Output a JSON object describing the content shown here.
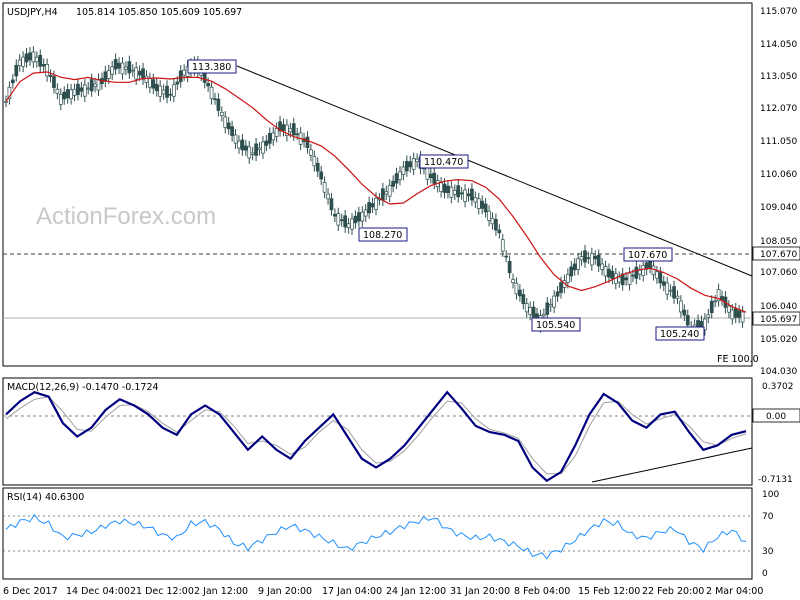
{
  "header": {
    "symbol": "USDJPY,H4",
    "ohlc": "105.814 105.850 105.609 105.697"
  },
  "watermark": "ActionForex.com",
  "colors": {
    "candle": "#2f4f4f",
    "ma": "#cc1111",
    "box_border": "#1a1a80",
    "macd_line": "#000080",
    "macd_signal": "#a0a0a0",
    "rsi": "#1e90ff",
    "grid_dash": "#808080",
    "trend": "#000000"
  },
  "price_panel": {
    "y_ticks": [
      "115.070",
      "114.050",
      "113.050",
      "112.070",
      "111.050",
      "110.060",
      "109.040",
      "108.050",
      "107.060",
      "106.040",
      "105.020",
      "104.030"
    ],
    "current_price": "105.697",
    "dashed_level": "107.670",
    "fe_label": "FE 100.0",
    "annotations": [
      {
        "text": "113.380",
        "value": 113.38
      },
      {
        "text": "110.470",
        "value": 110.47
      },
      {
        "text": "108.270",
        "value": 108.27
      },
      {
        "text": "107.670",
        "value": 107.67
      },
      {
        "text": "105.540",
        "value": 105.54
      },
      {
        "text": "105.240",
        "value": 105.24
      }
    ]
  },
  "macd_panel": {
    "title": "MACD(12,26,9) -0.1470 -0.1724",
    "y_ticks": [
      "0.3702",
      "0.00",
      "-0.7131"
    ],
    "zero_value": "0.00"
  },
  "rsi_panel": {
    "title": "RSI(14) 40.6300",
    "y_ticks": [
      "100",
      "70",
      "30",
      "0"
    ]
  },
  "x_axis": {
    "labels": [
      "6 Dec 2017",
      "14 Dec 04:00",
      "21 Dec 12:00",
      "2 Jan 12:00",
      "9 Jan 20:00",
      "17 Jan 04:00",
      "24 Jan 12:00",
      "31 Jan 20:00",
      "8 Feb 04:00",
      "15 Feb 12:00",
      "22 Feb 20:00",
      "2 Mar 04:00"
    ]
  },
  "chart_data": [
    {
      "type": "line",
      "title": "USDJPY,H4",
      "x_labels": [
        "6 Dec 2017",
        "14 Dec 04:00",
        "21 Dec 12:00",
        "2 Jan 12:00",
        "9 Jan 20:00",
        "17 Jan 04:00",
        "24 Jan 12:00",
        "31 Jan 20:00",
        "8 Feb 04:00",
        "15 Feb 12:00",
        "22 Feb 20:00",
        "2 Mar 04:00"
      ],
      "ylim": [
        104.03,
        115.07
      ],
      "series": [
        {
          "values": [
            112.3,
            113.5,
            113.7,
            113.3,
            112.4,
            112.6,
            112.7,
            112.9,
            113.4,
            113.3,
            113.1,
            112.7,
            112.5,
            113.2,
            113.4,
            112.6,
            111.7,
            111.0,
            110.7,
            111.0,
            111.5,
            111.4,
            111.0,
            110.0,
            108.8,
            108.5,
            108.8,
            109.2,
            109.6,
            110.2,
            110.5,
            110.0,
            109.6,
            109.5,
            109.4,
            109.0,
            108.3,
            106.8,
            106.0,
            105.6,
            106.2,
            106.9,
            107.5,
            107.5,
            107.0,
            106.8,
            107.0,
            107.3,
            106.7,
            106.3,
            105.3,
            105.5,
            106.4,
            105.8,
            105.7
          ]
        },
        {
          "name": "trendline",
          "values": [
            113.38,
            110.47,
            107.67,
            106.9
          ]
        }
      ]
    },
    {
      "type": "line",
      "title": "MACD(12,26,9) -0.1470 -0.1724",
      "ylim": [
        -0.7131,
        0.3702
      ],
      "series": [
        {
          "name": "MACD",
          "values": [
            0.05,
            0.2,
            0.3,
            0.25,
            -0.05,
            -0.2,
            -0.1,
            0.1,
            0.22,
            0.15,
            0.05,
            -0.1,
            -0.18,
            0.05,
            0.15,
            0.05,
            -0.15,
            -0.35,
            -0.2,
            -0.35,
            -0.45,
            -0.25,
            -0.1,
            0.05,
            -0.2,
            -0.45,
            -0.55,
            -0.45,
            -0.3,
            -0.1,
            0.1,
            0.3,
            0.12,
            -0.08,
            -0.15,
            -0.18,
            -0.25,
            -0.55,
            -0.7,
            -0.6,
            -0.3,
            0.05,
            0.28,
            0.18,
            -0.02,
            -0.1,
            0.05,
            0.08,
            -0.15,
            -0.35,
            -0.3,
            -0.18,
            -0.14
          ]
        },
        {
          "name": "Signal",
          "values": [
            0.0,
            0.12,
            0.22,
            0.25,
            0.08,
            -0.12,
            -0.14,
            0.02,
            0.15,
            0.16,
            0.08,
            -0.05,
            -0.15,
            -0.02,
            0.1,
            0.08,
            -0.08,
            -0.28,
            -0.25,
            -0.3,
            -0.4,
            -0.32,
            -0.15,
            -0.02,
            -0.12,
            -0.35,
            -0.5,
            -0.48,
            -0.36,
            -0.18,
            0.02,
            0.2,
            0.18,
            0.0,
            -0.12,
            -0.16,
            -0.22,
            -0.45,
            -0.62,
            -0.62,
            -0.42,
            -0.08,
            0.18,
            0.2,
            0.05,
            -0.06,
            0.0,
            0.05,
            -0.08,
            -0.26,
            -0.3,
            -0.22,
            -0.17
          ]
        },
        {
          "name": "trendline",
          "values": [
            -0.7,
            -0.35
          ]
        }
      ]
    },
    {
      "type": "line",
      "title": "RSI(14) 40.6300",
      "ylim": [
        0,
        100
      ],
      "series": [
        {
          "values": [
            55,
            65,
            70,
            62,
            45,
            48,
            52,
            60,
            66,
            63,
            58,
            48,
            44,
            62,
            65,
            55,
            38,
            32,
            42,
            52,
            60,
            54,
            46,
            38,
            30,
            38,
            46,
            52,
            60,
            66,
            70,
            56,
            48,
            44,
            46,
            40,
            34,
            24,
            22,
            30,
            42,
            55,
            66,
            62,
            48,
            44,
            52,
            56,
            40,
            30,
            46,
            54,
            40
          ]
        }
      ]
    }
  ]
}
